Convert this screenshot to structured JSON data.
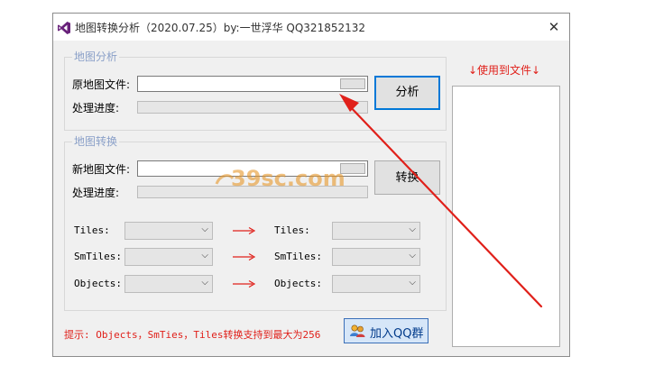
{
  "window": {
    "title": "地图转换分析（2020.07.25）by:一世浮华 QQ321852132",
    "close_symbol": "✕"
  },
  "analysis": {
    "group_title": "地图分析",
    "file_label": "原地图文件:",
    "file_value": "",
    "progress_label": "处理进度:",
    "progress": 0,
    "analyze_button": "分析"
  },
  "convert": {
    "group_title": "地图转换",
    "file_label": "新地图文件:",
    "file_value": "",
    "progress_label": "处理进度:",
    "progress": 0,
    "convert_button": "转换",
    "rows": [
      {
        "left_label": "Tiles:",
        "arrow": "——>",
        "right_label": "Tiles:"
      },
      {
        "left_label": "SmTiles:",
        "arrow": "——>",
        "right_label": "SmTiles:"
      },
      {
        "left_label": "Objects:",
        "arrow": "——>",
        "right_label": "Objects:"
      }
    ]
  },
  "hint": "提示: Objects，SmTies，Tiles转换支持到最大为256",
  "qq_button": "加入QQ群",
  "files_header": "↓使用到文件↓",
  "watermark": "39sc.com",
  "colors": {
    "hint_red": "#e0201a",
    "legend_blue": "#8aa0c8",
    "focus_blue": "#0078d7",
    "vs_purple": "#68217a"
  }
}
